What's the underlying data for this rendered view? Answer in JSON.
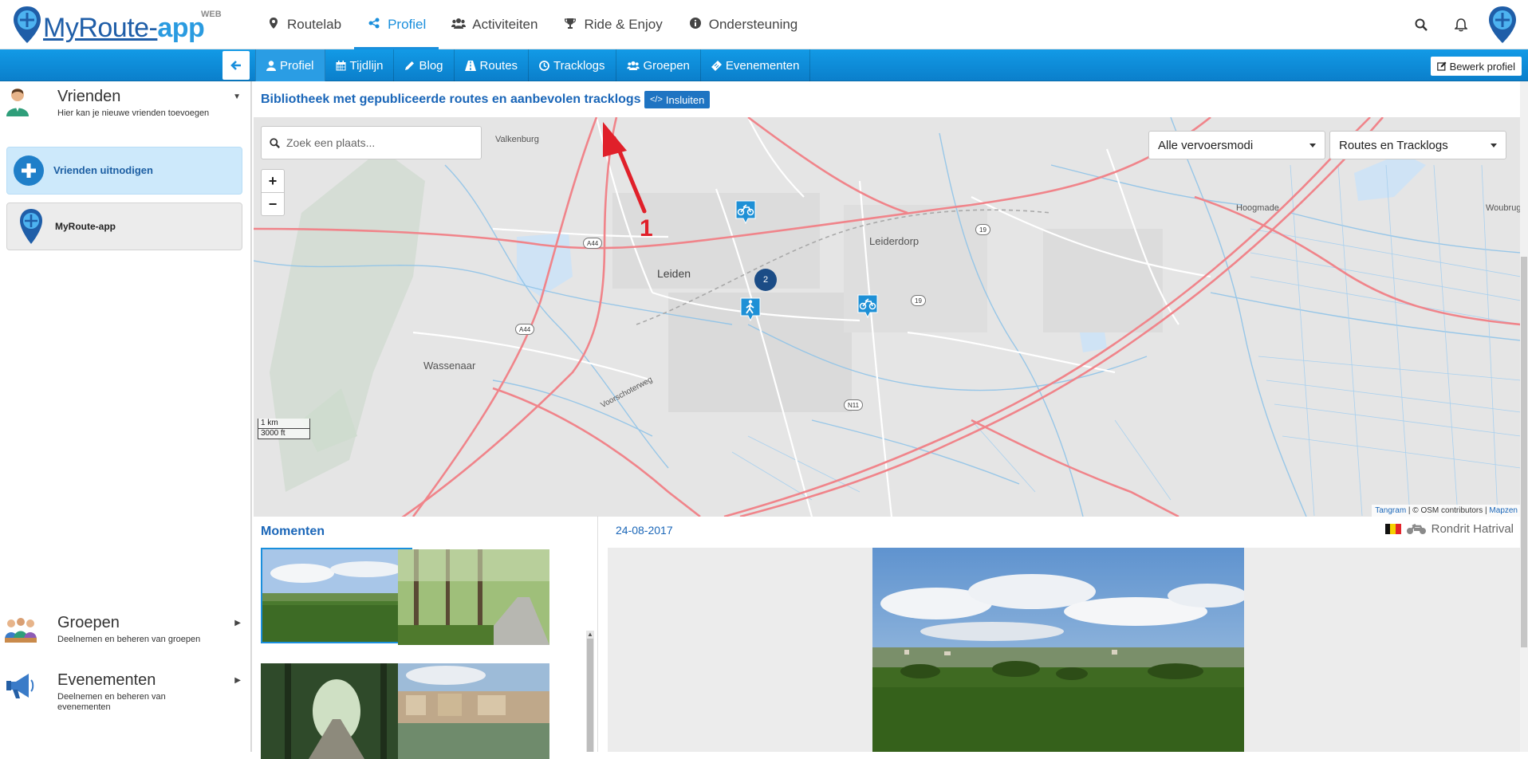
{
  "header": {
    "brand_part1": "MyRoute-",
    "brand_part2": "app",
    "brand_tag": "WEB",
    "nav": [
      {
        "label": "Routelab",
        "icon": "map-marker-icon",
        "active": false
      },
      {
        "label": "Profiel",
        "icon": "share-icon",
        "active": true
      },
      {
        "label": "Activiteiten",
        "icon": "users-icon",
        "active": false
      },
      {
        "label": "Ride & Enjoy",
        "icon": "trophy-icon",
        "active": false
      },
      {
        "label": "Ondersteuning",
        "icon": "info-circle-icon",
        "active": false
      }
    ],
    "icons": [
      "search-icon",
      "bell-icon",
      "user-pin-icon"
    ]
  },
  "subnav": {
    "tabs": [
      {
        "label": "Profiel",
        "icon": "user-icon",
        "active": true
      },
      {
        "label": "Tijdlijn",
        "icon": "calendar-icon",
        "active": false
      },
      {
        "label": "Blog",
        "icon": "pencil-icon",
        "active": false
      },
      {
        "label": "Routes",
        "icon": "road-icon",
        "active": false
      },
      {
        "label": "Tracklogs",
        "icon": "clock-icon",
        "active": false
      },
      {
        "label": "Groepen",
        "icon": "users-icon",
        "active": false
      },
      {
        "label": "Evenementen",
        "icon": "ticket-icon",
        "active": false
      }
    ],
    "edit_label": "Bewerk profiel"
  },
  "sidebar": {
    "friends": {
      "title": "Vrienden",
      "subtitle": "Hier kan je nieuwe vrienden toevoegen"
    },
    "invite_label": "Vrienden uitnodigen",
    "friend_name": "MyRoute-app",
    "groups": {
      "title": "Groepen",
      "subtitle": "Deelnemen en beheren van groepen"
    },
    "events": {
      "title": "Evenementen",
      "subtitle": "Deelnemen en beheren van evenementen"
    }
  },
  "library": {
    "title": "Bibliotheek met gepubliceerde routes en aanbevolen tracklogs",
    "embed_label": "Insluiten"
  },
  "map": {
    "search_placeholder": "Zoek een plaats...",
    "zoom_in": "+",
    "zoom_out": "−",
    "mode_select": "Alle vervoersmodi",
    "type_select": "Routes en Tracklogs",
    "places": {
      "leiden": "Leiden",
      "leiderdorp": "Leiderdorp",
      "wassenaar": "Wassenaar",
      "valkenburg": "Valkenburg",
      "hoogmade": "Hoogmade",
      "woubrugge": "Woubrugge",
      "vooorschoterweg": "Voorschoterweg"
    },
    "roads": {
      "a44a": "A44",
      "a44b": "A44",
      "n19a": "19",
      "n19b": "19",
      "n11": "N11"
    },
    "cluster_count": "2",
    "scale_km": "1 km",
    "scale_ft": "3000 ft",
    "attribution": {
      "tangram": "Tangram",
      "osm": " | © OSM contributors | ",
      "mapzen": "Mapzen"
    },
    "annotation_number": "1"
  },
  "moments": {
    "title": "Momenten"
  },
  "detail": {
    "date": "24-08-2017",
    "route_name": "Rondrit Hatrival"
  },
  "colors": {
    "accent": "#1a8fdc",
    "brand_dark": "#1f5ea8",
    "title_blue": "#1a66b8",
    "annotation_red": "#e0202a"
  }
}
